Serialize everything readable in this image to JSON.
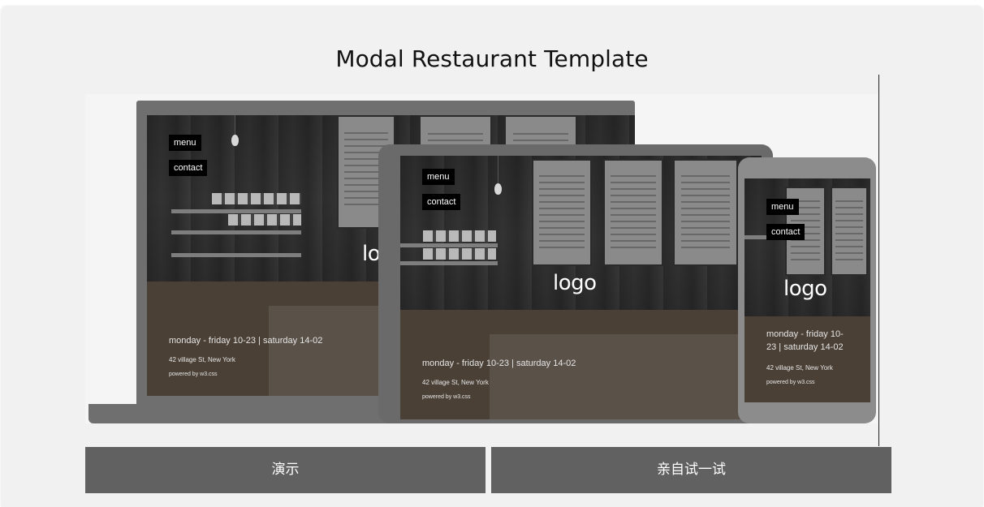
{
  "page": {
    "title": "Modal Restaurant Template"
  },
  "preview": {
    "nav": {
      "menu": "menu",
      "contact": "contact"
    },
    "logo": "logo",
    "hours": "monday - friday 10-23 | saturday 14-02",
    "hours_phone_line1": "monday - friday 10-",
    "hours_phone_line2": "23 | saturday 14-02",
    "address": "42 village St, New York",
    "powered": "powered by w3.css"
  },
  "actions": {
    "demo": "演示",
    "try": "亲自试一试"
  },
  "colors": {
    "background": "#f1f1f1",
    "button": "#616161",
    "frame": "#6f6f6f"
  }
}
